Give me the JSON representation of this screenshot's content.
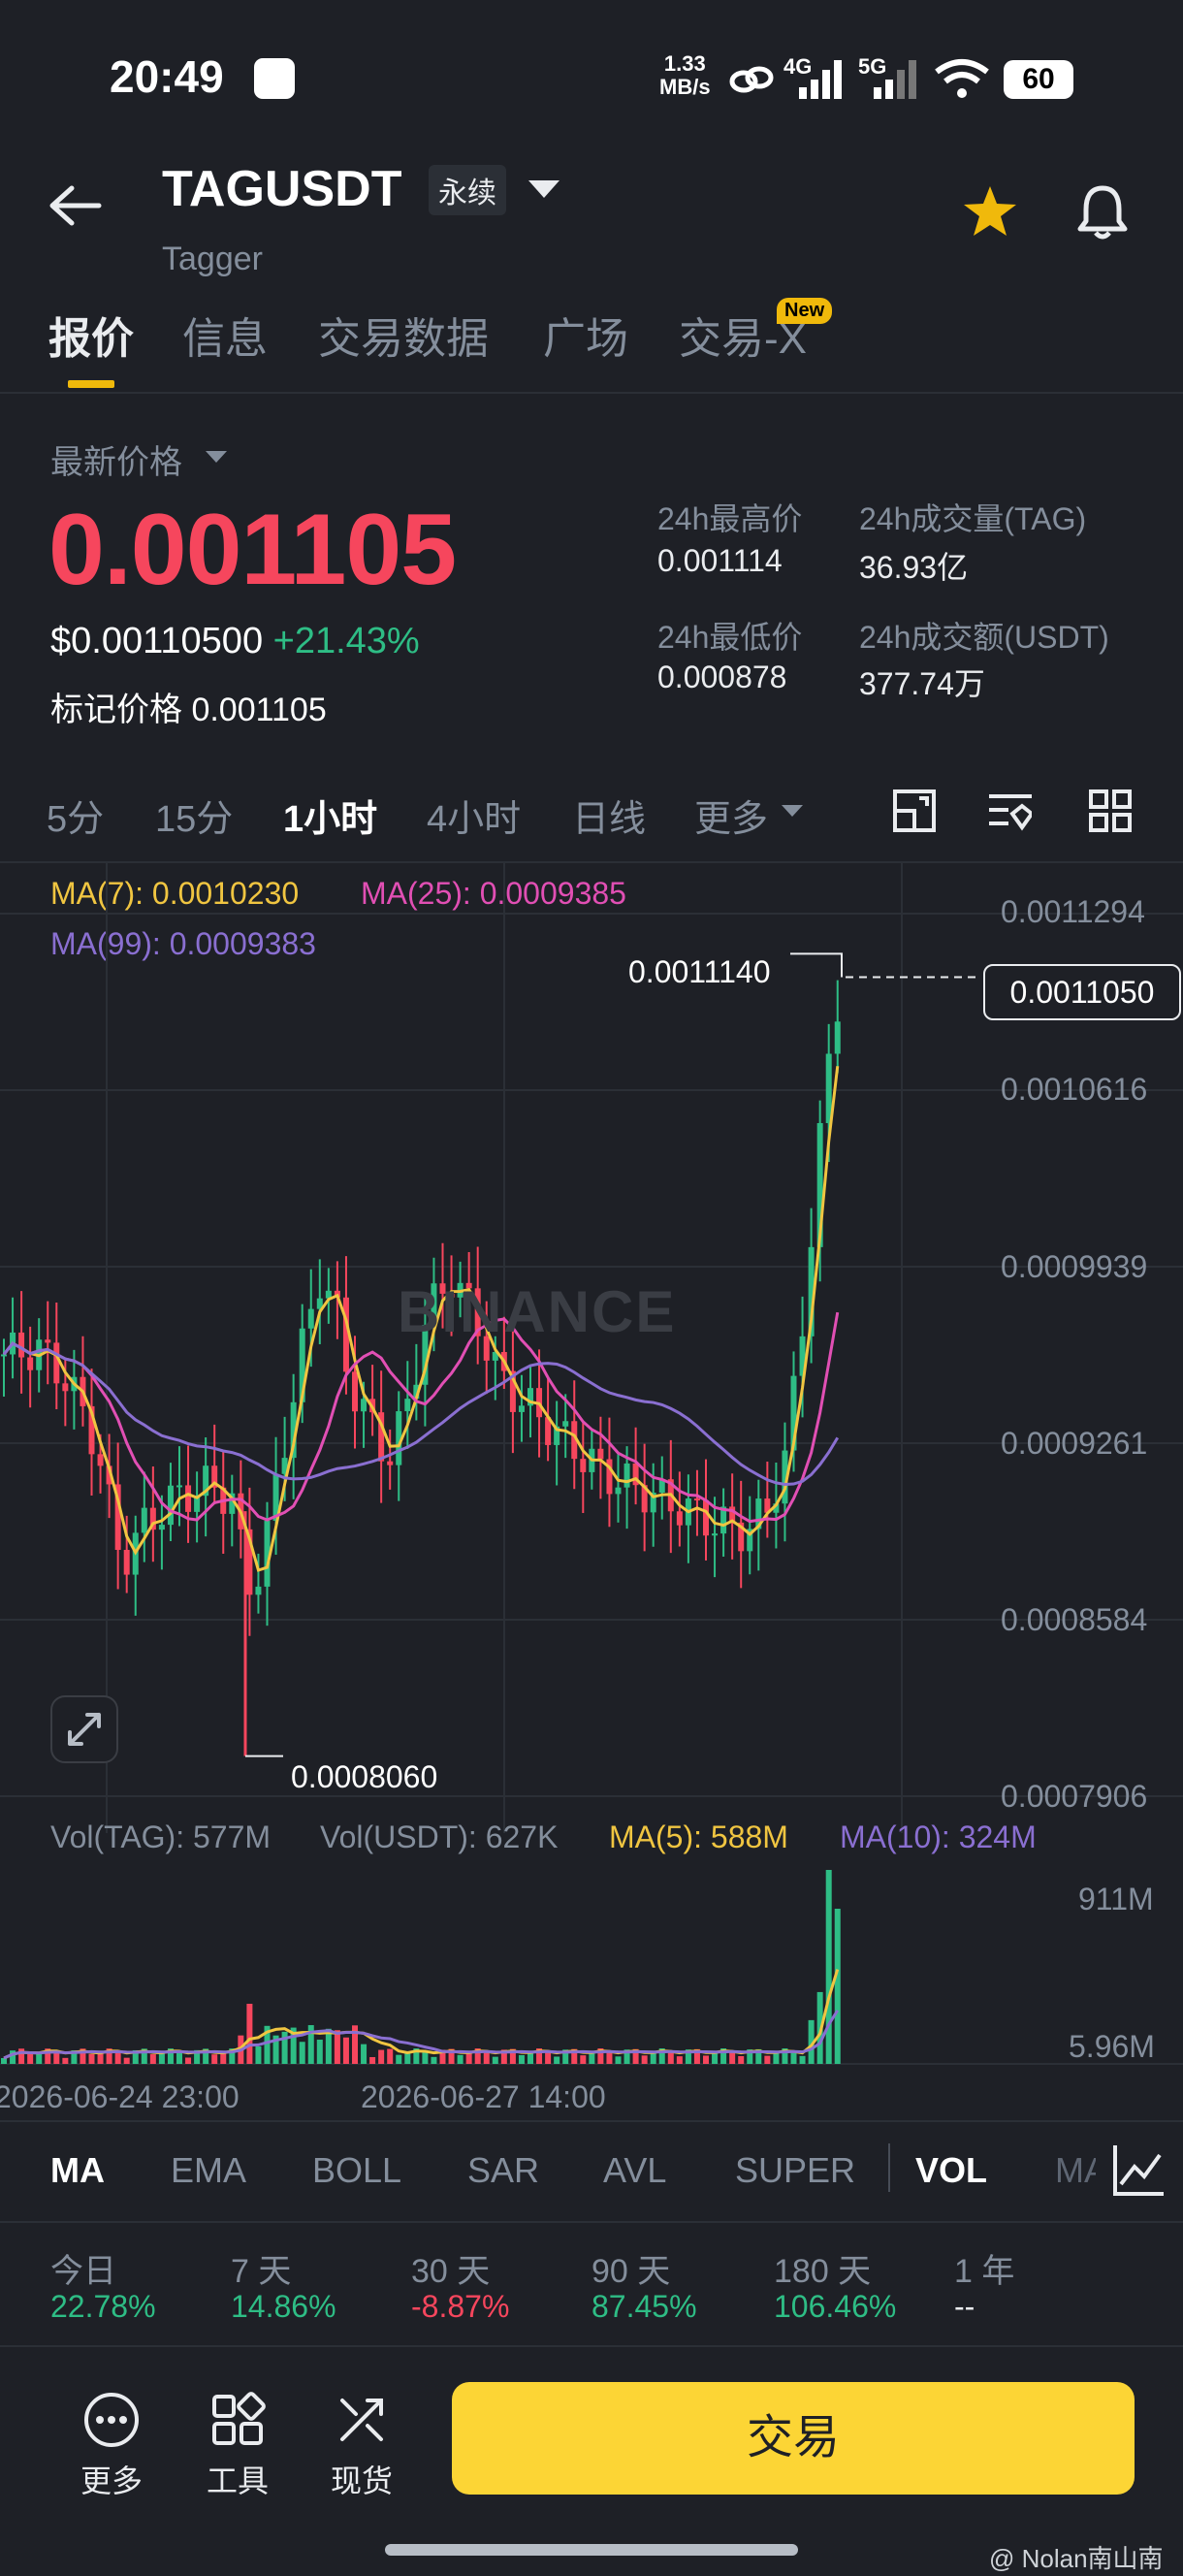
{
  "status_bar": {
    "time": "20:49",
    "speed": "1.33",
    "speed_unit": "MB/s",
    "net1": "4G",
    "net2": "5G",
    "battery": "60"
  },
  "header": {
    "symbol": "TAGUSDT",
    "contract_type": "永续",
    "name": "Tagger",
    "icons": [
      "back-arrow-icon",
      "star-icon",
      "bell-icon"
    ]
  },
  "tabs": [
    "报价",
    "信息",
    "交易数据",
    "广场",
    "交易-X"
  ],
  "new_badge": "New",
  "price": {
    "latest_label": "最新价格",
    "last": "0.001105",
    "usd": "$0.00110500",
    "change": "+21.43%",
    "mark_label": "标记价格",
    "mark": "0.001105"
  },
  "stats": {
    "high_label": "24h最高价",
    "high": "0.001114",
    "vol_tag_label": "24h成交量(TAG)",
    "vol_tag": "36.93亿",
    "low_label": "24h最低价",
    "low": "0.000878",
    "vol_usdt_label": "24h成交额(USDT)",
    "vol_usdt": "377.74万"
  },
  "intervals": [
    "5分",
    "15分",
    "1小时",
    "4小时",
    "日线",
    "更多"
  ],
  "active_interval": "1小时",
  "colors": {
    "up": "#2ebd85",
    "down": "#f6465d",
    "ma7": "#f0c541",
    "ma25": "#e14fb4",
    "ma99": "#8a6fd1",
    "accent": "#f0b90b"
  },
  "chart_data": {
    "type": "candlestick",
    "legend": {
      "ma7": "MA(7): 0.0010230",
      "ma25": "MA(25): 0.0009385",
      "ma99": "MA(99): 0.0009383"
    },
    "y_ticks": [
      "0.0011294",
      "0.0010616",
      "0.0009939",
      "0.0009261",
      "0.0008584",
      "0.0007906"
    ],
    "ylim": [
      0.0007906,
      0.0011294
    ],
    "current_price": "0.0011050",
    "max_label": "0.0011140",
    "min_label": "0.0008060",
    "watermark": "BINANCE",
    "x_labels": [
      "2026-06-24 23:00",
      "2026-06-27 14:00"
    ],
    "volume": {
      "vol_tag": "Vol(TAG): 577M",
      "vol_usdt": "Vol(USDT): 627K",
      "ma5": "MA(5): 588M",
      "ma10": "MA(10): 324M",
      "y_ticks": [
        "911M",
        "5.96M"
      ]
    }
  },
  "indicator_tabs": [
    "MA",
    "EMA",
    "BOLL",
    "SAR",
    "AVL",
    "SUPER",
    "VOL",
    "MA"
  ],
  "performance": [
    {
      "label": "今日",
      "value": "22.78%"
    },
    {
      "label": "7 天",
      "value": "14.86%"
    },
    {
      "label": "30 天",
      "value": "-8.87%"
    },
    {
      "label": "90 天",
      "value": "87.45%"
    },
    {
      "label": "180 天",
      "value": "106.46%"
    },
    {
      "label": "1 年",
      "value": "--"
    }
  ],
  "bottom": {
    "more": "更多",
    "tools": "工具",
    "spot": "现货",
    "trade": "交易"
  },
  "watermark": "@ Nolan南山南"
}
